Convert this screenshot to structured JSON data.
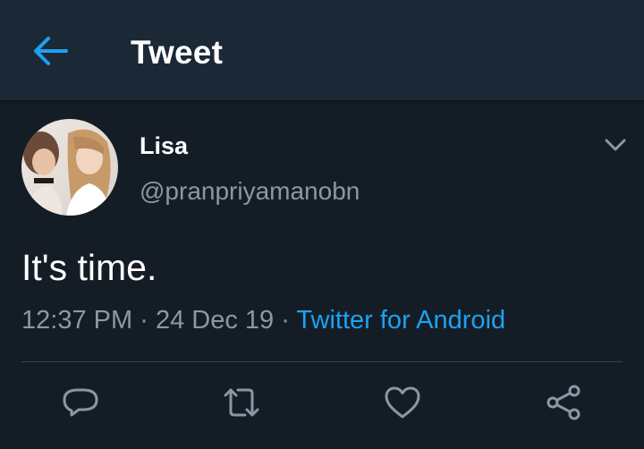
{
  "header": {
    "back_icon": "arrow-left-icon",
    "title": "Tweet"
  },
  "tweet": {
    "author": {
      "display_name": "Lisa",
      "handle": "@pranpriyamanobn"
    },
    "text": "It's time.",
    "time": "12:37 PM",
    "date": "24 Dec 19",
    "separator": "·",
    "source": "Twitter for Android"
  },
  "actions": [
    {
      "name": "reply",
      "icon": "reply-bubble-icon"
    },
    {
      "name": "retweet",
      "icon": "retweet-icon"
    },
    {
      "name": "like",
      "icon": "heart-icon"
    },
    {
      "name": "share",
      "icon": "share-icon"
    }
  ],
  "colors": {
    "background": "#141d26",
    "header": "#1b2836",
    "accent": "#1da1f2",
    "secondary_text": "#8899a6",
    "divider": "#38444d"
  }
}
